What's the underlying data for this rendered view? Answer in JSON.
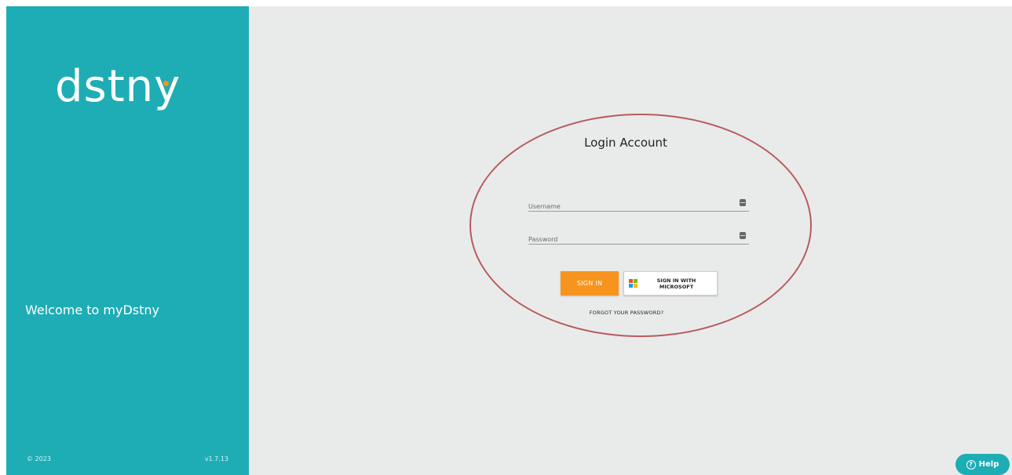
{
  "sidebar": {
    "logo_text": "dstny",
    "welcome": "Welcome to myDstny",
    "copyright": "© 2023",
    "version": "v1.7.13"
  },
  "login": {
    "title": "Login Account",
    "username_placeholder": "Username",
    "password_placeholder": "Password",
    "signin_label": "SIGN IN",
    "microsoft_label": "SIGN IN WITH MICROSOFT",
    "forgot_label": "FORGOT YOUR PASSWORD?"
  },
  "help": {
    "label": "Help"
  },
  "colors": {
    "brand_teal": "#1eadb5",
    "accent_orange": "#f7941d",
    "background": "#e9ebea",
    "annotation_ellipse": "#b85b5d"
  }
}
